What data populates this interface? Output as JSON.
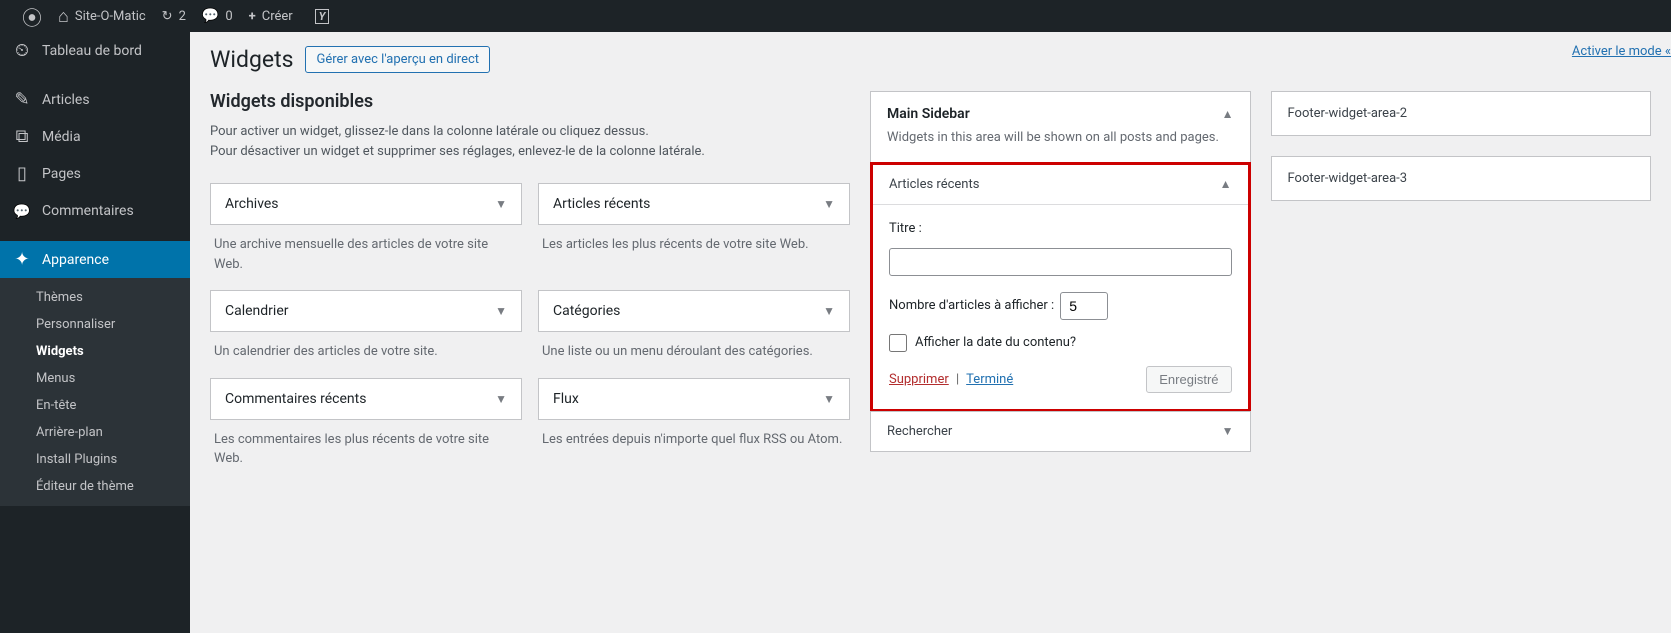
{
  "adminbar": {
    "site_name": "Site-O-Matic",
    "updates_count": "2",
    "comments_count": "0",
    "new_label": "Créer"
  },
  "menu": {
    "dashboard": "Tableau de bord",
    "posts": "Articles",
    "media": "Média",
    "pages": "Pages",
    "comments": "Commentaires",
    "appearance": "Apparence",
    "appearance_sub": {
      "themes": "Thèmes",
      "customize": "Personnaliser",
      "widgets": "Widgets",
      "menus": "Menus",
      "header": "En-tête",
      "background": "Arrière-plan",
      "install_plugins": "Install Plugins",
      "editor": "Éditeur de thème"
    }
  },
  "page": {
    "header_link": "Activer le mode «",
    "title": "Widgets",
    "title_action": "Gérer avec l'aperçu en direct",
    "available_title": "Widgets disponibles",
    "available_desc1": "Pour activer un widget, glissez-le dans la colonne latérale ou cliquez dessus.",
    "available_desc2": "Pour désactiver un widget et supprimer ses réglages, enlevez-le de la colonne latérale."
  },
  "available_widgets": [
    {
      "name": "Archives",
      "desc": "Une archive mensuelle des articles de votre site Web."
    },
    {
      "name": "Articles récents",
      "desc": "Les articles les plus récents de votre site Web."
    },
    {
      "name": "Calendrier",
      "desc": "Un calendrier des articles de votre site."
    },
    {
      "name": "Catégories",
      "desc": "Une liste ou un menu déroulant des catégories."
    },
    {
      "name": "Commentaires récents",
      "desc": "Les commentaires les plus récents de votre site Web."
    },
    {
      "name": "Flux",
      "desc": "Les entrées depuis n'importe quel flux RSS ou Atom."
    }
  ],
  "main_sidebar": {
    "title": "Main Sidebar",
    "desc": "Widgets in this area will be shown on all posts and pages.",
    "recent_posts": {
      "title": "Articles récents",
      "label_title": "Titre :",
      "value_title": "",
      "label_count": "Nombre d'articles à afficher :",
      "value_count": "5",
      "label_showdate": "Afficher la date du contenu?",
      "action_delete": "Supprimer",
      "action_done": "Terminé",
      "action_saved": "Enregistré"
    },
    "search": {
      "title": "Rechercher"
    }
  },
  "footer2": {
    "title": "Footer-widget-area-2"
  },
  "footer3": {
    "title": "Footer-widget-area-3"
  }
}
